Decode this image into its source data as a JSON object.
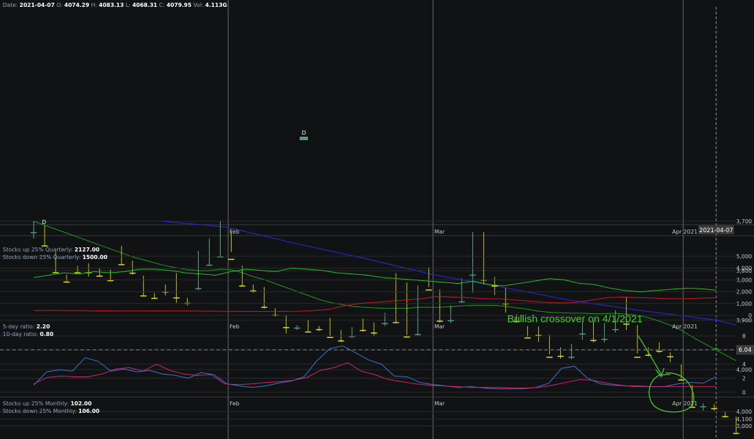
{
  "header": {
    "date_label": "Date:",
    "date": "2021-04-07",
    "open_label": "O:",
    "open": "4074.29",
    "high_label": "H:",
    "high": "4083.13",
    "low_label": "L:",
    "low": "4068.31",
    "close_label": "C:",
    "close": "4079.95",
    "vol_label": "Vol:",
    "vol": "4.113G"
  },
  "panel2": {
    "label1": "Stocks up 25% Quarterly:",
    "value1": "2127.00",
    "label2": "Stocks down 25% Quarterly:",
    "value2": "1500.00"
  },
  "panel3": {
    "label1": "5-day ratio:",
    "value1": "2.20",
    "label2": "10-day ratio:",
    "value2": "0.80"
  },
  "panel4": {
    "label1": "Stocks up 25% Monthly:",
    "value1": "102.00",
    "label2": "Stocks down 25% Monthly:",
    "value2": "106.00"
  },
  "annotation": "Bullish crossover on 4/1/2021",
  "colors": {
    "up": "#e1e11c",
    "down": "#4e9e7e",
    "ma_short": "#1e9e1e",
    "ma_long": "#2727c8",
    "green": "#22c422",
    "red": "#c81e1e",
    "blue": "#3a78d8",
    "pink": "#d0286e",
    "annot": "#43d11f",
    "bg": "#111214",
    "grid": "#2a2c30"
  },
  "chart_data": [
    {
      "type": "candlestick",
      "x_labels": [
        "Feb",
        "Mar",
        "Apr 2021"
      ],
      "current_date_tag": "2021-04-07",
      "y_ticks": [
        "3,700",
        "3,800",
        "3,900",
        "4,000",
        "4,100"
      ],
      "ylim": [
        3690,
        4130
      ],
      "markers": [
        "D",
        "D"
      ],
      "ohlc": [
        [
          3722,
          3735,
          3700,
          3702
        ],
        [
          3714,
          3750,
          3708,
          3749
        ],
        [
          3766,
          3805,
          3762,
          3803
        ],
        [
          3812,
          3823,
          3808,
          3822
        ],
        [
          3799,
          3804,
          3790,
          3803
        ],
        [
          3803,
          3812,
          3785,
          3803
        ],
        [
          3803,
          3812,
          3795,
          3810
        ],
        [
          3807,
          3822,
          3798,
          3819
        ],
        [
          3768,
          3788,
          3750,
          3787
        ],
        [
          3787,
          3808,
          3780,
          3804
        ],
        [
          3816,
          3852,
          3810,
          3850
        ],
        [
          3850,
          3857,
          3845,
          3855
        ],
        [
          3842,
          3850,
          3828,
          3842
        ],
        [
          3850,
          3865,
          3805,
          3854
        ],
        [
          3862,
          3870,
          3855,
          3865
        ],
        [
          3835,
          3840,
          3760,
          3752
        ],
        [
          3788,
          3790,
          3735,
          3754
        ],
        [
          3771,
          3773,
          3700,
          3716
        ],
        [
          3734,
          3762,
          3720,
          3776
        ],
        [
          3797,
          3832,
          3790,
          3830
        ],
        [
          3832,
          3845,
          3828,
          3840
        ],
        [
          3836,
          3877,
          3833,
          3873
        ],
        [
          3880,
          3893,
          3876,
          3889
        ],
        [
          3893,
          3927,
          3890,
          3914
        ],
        [
          3915,
          3920,
          3910,
          3914
        ],
        [
          3912,
          3925,
          3900,
          3923
        ],
        [
          3917,
          3922,
          3912,
          3918
        ],
        [
          3920,
          3932,
          3895,
          3934
        ],
        [
          3934,
          3945,
          3920,
          3941
        ],
        [
          3932,
          3936,
          3914,
          3919
        ],
        [
          3915,
          3923,
          3897,
          3920
        ],
        [
          3916,
          3932,
          3905,
          3925
        ],
        [
          3906,
          3912,
          3885,
          3892
        ],
        [
          3883,
          3905,
          3805,
          3904
        ],
        [
          3877,
          3930,
          3824,
          3933
        ],
        [
          3928,
          3932,
          3830,
          3827
        ],
        [
          3808,
          3833,
          3793,
          3838
        ],
        [
          3840,
          3905,
          3838,
          3901
        ],
        [
          3900,
          3906,
          3870,
          3870
        ],
        [
          3862,
          3865,
          3815,
          3818
        ],
        [
          3808,
          3845,
          3722,
          3768
        ],
        [
          3773,
          3828,
          3722,
          3818
        ],
        [
          3815,
          3849,
          3813,
          3830
        ],
        [
          3842,
          3885,
          3835,
          3866
        ],
        [
          3896,
          3905,
          3888,
          3902
        ],
        [
          3915,
          3934,
          3912,
          3935
        ],
        [
          3918,
          3944,
          3913,
          3930
        ],
        [
          3949,
          3969,
          3930,
          3974
        ],
        [
          3961,
          3978,
          3955,
          3972
        ],
        [
          3974,
          3979,
          3948,
          3946
        ],
        [
          3927,
          3940,
          3903,
          3918
        ],
        [
          3917,
          3945,
          3902,
          3940
        ],
        [
          3938,
          3945,
          3906,
          3917
        ],
        [
          3918,
          3925,
          3880,
          3891
        ],
        [
          3875,
          3920,
          3853,
          3907
        ],
        [
          3913,
          3967,
          3910,
          3974
        ],
        [
          3969,
          3973,
          3955,
          3970
        ],
        [
          3958,
          3966,
          3945,
          3962
        ],
        [
          3967,
          3985,
          3965,
          3973
        ],
        [
          3992,
          4020,
          3989,
          4020
        ],
        [
          4033,
          4074,
          4031,
          4075
        ],
        [
          4074,
          4083,
          4068,
          4072
        ],
        [
          4073,
          4083,
          4070,
          4078
        ],
        [
          4087,
          4097,
          4084,
          4094
        ],
        [
          4096,
          4130,
          4095,
          4128
        ]
      ],
      "ma_short": [
        3700,
        3708,
        3716,
        3724,
        3732,
        3740,
        3748,
        3756,
        3764,
        3772,
        3778,
        3784,
        3790,
        3794,
        3798,
        3800,
        3800,
        3797,
        3798,
        3804,
        3812,
        3818,
        3826,
        3834,
        3842,
        3850,
        3858,
        3864,
        3868,
        3872,
        3874,
        3875,
        3876,
        3876,
        3876,
        3874,
        3874,
        3874,
        3873,
        3871,
        3870,
        3870,
        3870,
        3872,
        3875,
        3878,
        3882,
        3884,
        3885,
        3886,
        3886,
        3887,
        3887,
        3886,
        3888,
        3890,
        3895,
        3902,
        3910,
        3920,
        3934,
        3946,
        3958,
        3970,
        3982
      ]
    },
    {
      "type": "line",
      "y_ticks": [
        "0",
        "1,000",
        "2,000",
        "3,000",
        "4,000",
        "5,000"
      ],
      "ylim": [
        0,
        5000
      ],
      "series": [
        {
          "name": "Stocks up 25% Quarterly",
          "values": [
            3200,
            3400,
            3600,
            3500,
            3700,
            3600,
            3700,
            3900,
            3900,
            3800,
            3600,
            3500,
            3400,
            3700,
            3900,
            3800,
            3700,
            4000,
            3900,
            3800,
            3600,
            3500,
            3400,
            3200,
            3100,
            3000,
            2900,
            2800,
            2700,
            2900,
            2600,
            2500,
            2700,
            2900,
            3100,
            3000,
            2700,
            2600,
            2300,
            2100,
            2000,
            2100,
            2200,
            2300,
            2250,
            2127
          ]
        },
        {
          "name": "Stocks down 25% Quarterly",
          "values": [
            400,
            420,
            410,
            400,
            380,
            380,
            360,
            370,
            380,
            360,
            370,
            350,
            340,
            330,
            330,
            320,
            330,
            340,
            400,
            500,
            800,
            1000,
            1100,
            1200,
            1300,
            1400,
            1600,
            1550,
            1500,
            1400,
            1400,
            1300,
            1200,
            1100,
            1050,
            1100,
            1300,
            1500,
            1550,
            1500,
            1450,
            1400,
            1400,
            1450,
            1500
          ]
        }
      ]
    },
    {
      "type": "line",
      "y_ticks": [
        "0",
        "2",
        "4",
        "6",
        "8"
      ],
      "ylim": [
        -0.6,
        8.6
      ],
      "ref_line": 6.04,
      "ref_label": "6.04",
      "series": [
        {
          "name": "5-day ratio",
          "values": [
            1.0,
            2.9,
            3.2,
            3.0,
            4.9,
            4.4,
            3.0,
            3.3,
            2.9,
            3.1,
            2.6,
            2.4,
            2.0,
            2.8,
            2.5,
            1.2,
            0.9,
            0.7,
            0.9,
            1.3,
            1.6,
            2.2,
            4.5,
            6.2,
            6.6,
            5.6,
            4.6,
            4.0,
            2.3,
            2.2,
            1.4,
            1.1,
            0.9,
            0.7,
            0.8,
            0.6,
            0.5,
            0.5,
            0.5,
            0.7,
            1.3,
            3.4,
            3.7,
            2.0,
            1.2,
            1.0,
            0.9,
            0.9,
            0.8,
            0.8,
            1.2,
            1.4,
            1.3,
            2.2
          ]
        },
        {
          "name": "10-day ratio",
          "values": [
            1.2,
            2.1,
            2.3,
            2.2,
            2.2,
            2.6,
            3.3,
            3.5,
            3.0,
            4.0,
            3.1,
            2.6,
            2.4,
            2.5,
            1.2,
            1.1,
            1.2,
            1.4,
            1.5,
            1.7,
            2.1,
            3.1,
            3.5,
            4.2,
            3.0,
            2.5,
            1.8,
            1.5,
            1.2,
            1.0,
            0.9,
            0.8,
            0.7,
            0.7,
            0.7,
            0.6,
            0.6,
            0.7,
            1.0,
            1.4,
            1.8,
            1.7,
            1.3,
            1.0,
            0.8,
            0.8,
            0.8,
            0.8,
            0.8,
            0.8,
            0.8
          ]
        }
      ]
    },
    {
      "type": "line",
      "y_ticks": [
        "3,000",
        "4,000"
      ],
      "series": [
        {
          "name": "Stocks up 25% Monthly",
          "values": [
            102
          ]
        },
        {
          "name": "Stocks down 25% Monthly",
          "values": [
            106
          ]
        }
      ]
    }
  ]
}
